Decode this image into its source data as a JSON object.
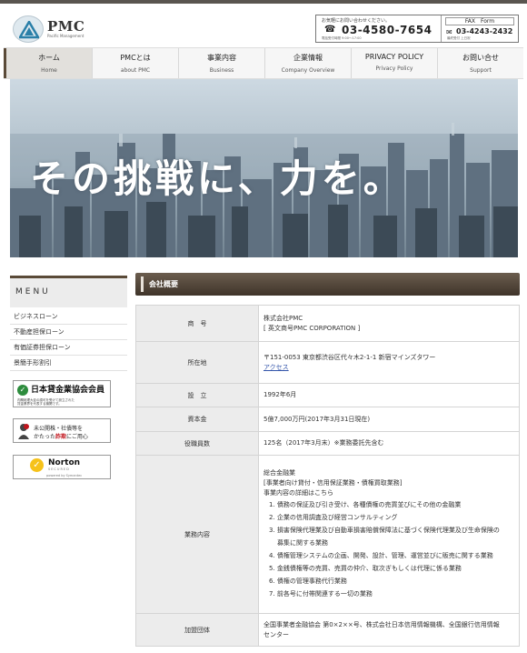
{
  "header": {
    "logo_name": "PMC",
    "logo_sub": "Pacific Management",
    "contact_caption": "お気軽にお問い合わせください。",
    "phone": "03-4580-7654",
    "hours": "電話受付時間 9:00〜17:00",
    "fax_label": "FAX　Form",
    "fax": "03-4243-2432",
    "fax_note": "最終受付 上日祝"
  },
  "nav": [
    {
      "label": "ホーム",
      "sub": "Home"
    },
    {
      "label": "PMCとは",
      "sub": "about PMC"
    },
    {
      "label": "事業内容",
      "sub": "Business"
    },
    {
      "label": "企業情報",
      "sub": "Company Overview"
    },
    {
      "label": "PRIVACY POLICY",
      "sub": "Privacy Policy"
    },
    {
      "label": "お問い合せ",
      "sub": "Support"
    }
  ],
  "hero": {
    "copy": "その挑戦に、力を。"
  },
  "sidebar": {
    "menu_title": "MENU",
    "items": [
      "ビジネスローン",
      "不動産担保ローン",
      "有価証券担保ローン",
      "景簡手形割引"
    ],
    "banner1_title": "日本貸金業協会会員",
    "banner1_note": "内閣総理大臣の認可を受けて設立された\n貸金業界を代表する機関です。",
    "banner2_line1": "未公開株・社債等を",
    "banner2_line2a": "かたった",
    "banner2_line2b": "詐欺",
    "banner2_line2c": "にご用心",
    "banner3_name": "Norton",
    "banner3_sub": "SECURED",
    "banner3_by": "powered by Symantec"
  },
  "section": {
    "title": "会社概要"
  },
  "table": {
    "name_label": "商　号",
    "name_value1": "株式会社PMC",
    "name_value2": "[ 英文商号PMC CORPORATION ]",
    "address_label": "所在地",
    "address_value": "〒151-0053 東京都渋谷区代々木2-1-1 新宿マインズタワー",
    "access_link": "アクセス",
    "founded_label": "設　立",
    "founded_value": "1992年6月",
    "capital_label": "資本金",
    "capital_value": "5億7,000万円(2017年3月31日現在)",
    "staff_label": "役職員数",
    "staff_value": "125名（2017年3月末）※業務委託先含む",
    "business_label": "業務内容",
    "business_intro1": "総合金融業",
    "business_intro2": "[事業者向け貸付・信用保証業務・債権買取業務]",
    "business_intro3": "事業内容の詳細はこちら",
    "business_items": [
      "1. 債務の保証及び引き受け、各種債権の売買並びにその他の金融業",
      "2. 企業の信用調査及び経営コンサルティング",
      "3. 損害保険代理業及び自動車損害賠償保障法に基づく保険代理業及び生命保険の",
      "募集に関する業務",
      "4. 債権管理システムの企画、開発、設計、管理、運営並びに販売に関する業務",
      "5. 金銭債権等の売買、売買の仲介、取次ぎもしくは代理に係る業務",
      "6. 債権の管理事務代行業務",
      "7. 前各号に付帯関連する一切の業務"
    ],
    "org_label": "加盟団体",
    "org_value1": "全国事業者金融協会 第0×2××号、株式会社日本信用情報機構、全国銀行信用情報",
    "org_value2": "センター"
  }
}
